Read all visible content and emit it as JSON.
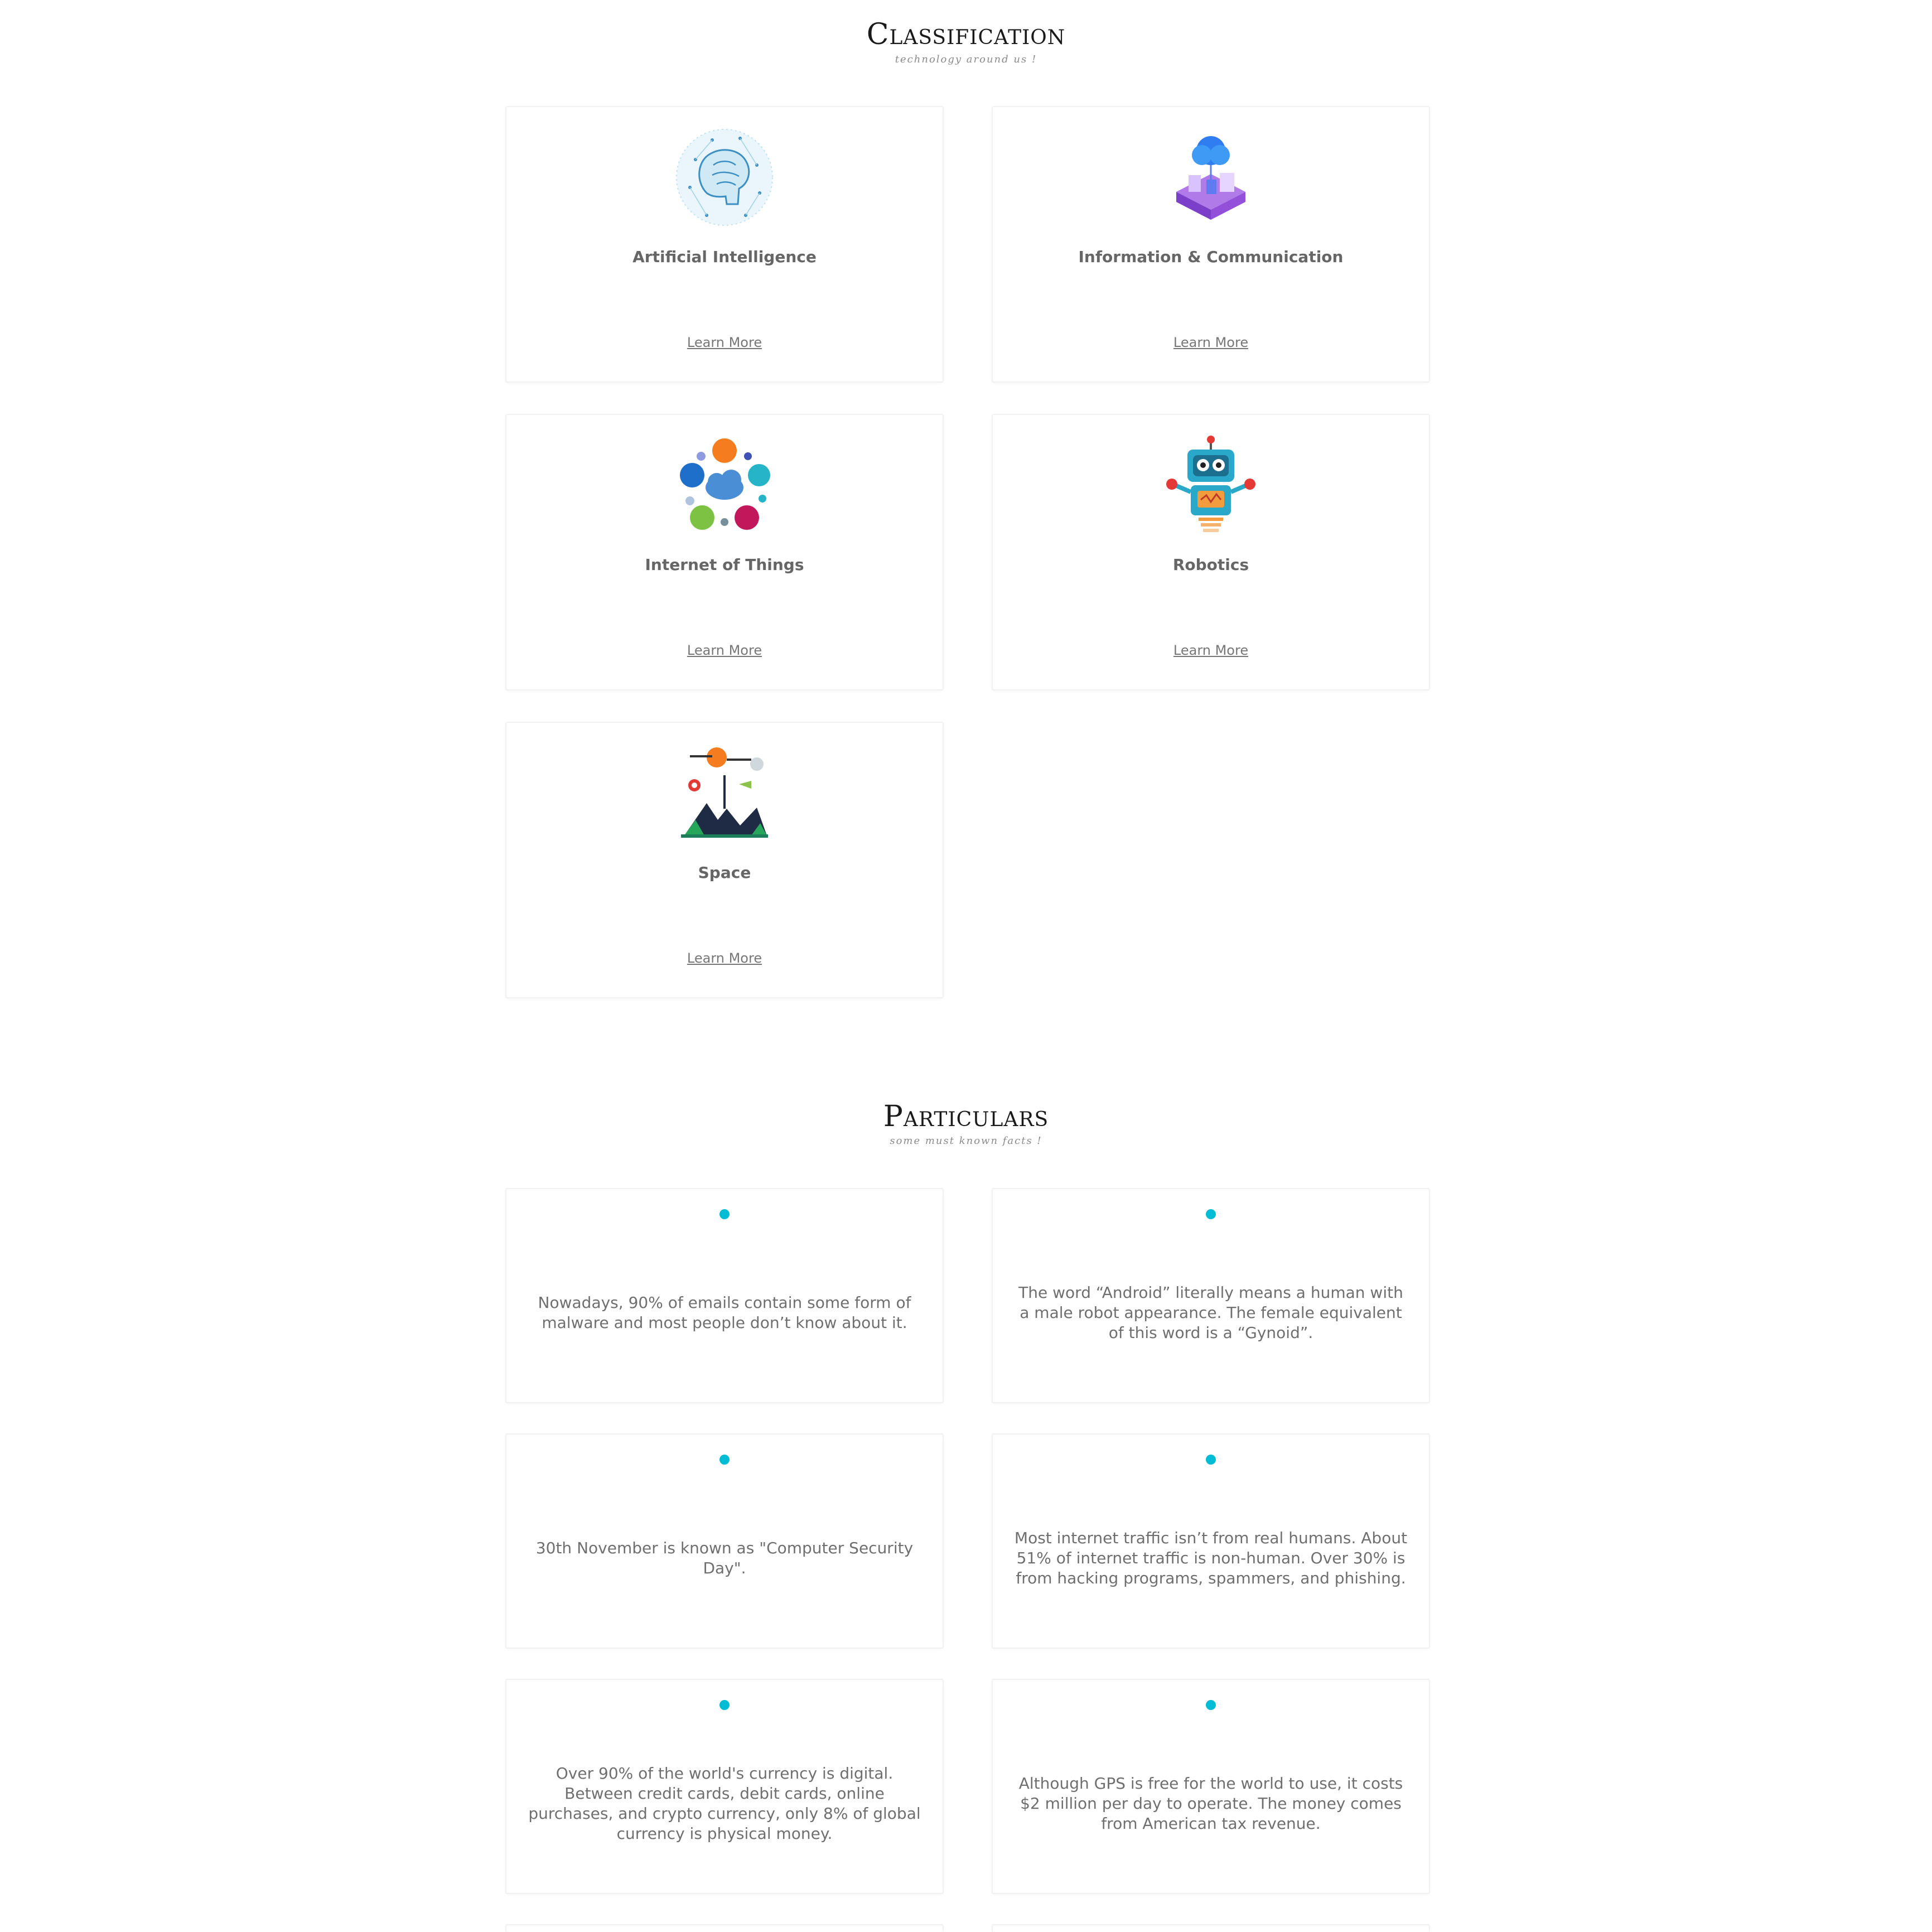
{
  "classification": {
    "title": "Classification",
    "subtitle": "technology around us !",
    "cards": [
      {
        "title": "Artificial Intelligence",
        "link": "Learn More",
        "icon": "brain-icon"
      },
      {
        "title": "Information & Communication",
        "link": "Learn More",
        "icon": "isometric-cloud-icon"
      },
      {
        "title": "Internet of Things",
        "link": "Learn More",
        "icon": "iot-cloud-icon"
      },
      {
        "title": "Robotics",
        "link": "Learn More",
        "icon": "robot-icon"
      },
      {
        "title": "Space",
        "link": "Learn More",
        "icon": "space-icon"
      }
    ]
  },
  "particulars": {
    "title": "Particulars",
    "subtitle": "some must known facts !",
    "facts": [
      {
        "text": "Nowadays, 90% of emails contain some form of malware and most people don’t know about it."
      },
      {
        "text": "The word “Android” literally means a human with a male robot appearance. The female equivalent of this word is a “Gynoid”."
      },
      {
        "text": "30th November is known as \"Computer Security Day\"."
      },
      {
        "text": "Most internet traffic isn’t from real humans. About 51% of internet traffic is non-human. Over 30% is from hacking programs, spammers, and phishing."
      },
      {
        "text": "Over 90% of the world's currency is digital. Between credit cards, debit cards, online purchases, and crypto currency, only 8% of global currency is physical money."
      },
      {
        "text": "Although GPS is free for the world to use, it costs $2 million per day to operate. The money comes from American tax revenue."
      }
    ]
  },
  "colors": {
    "accent_dot": "#00bcd4",
    "heading": "#1a1a1a",
    "text": "#6f6f6f"
  }
}
